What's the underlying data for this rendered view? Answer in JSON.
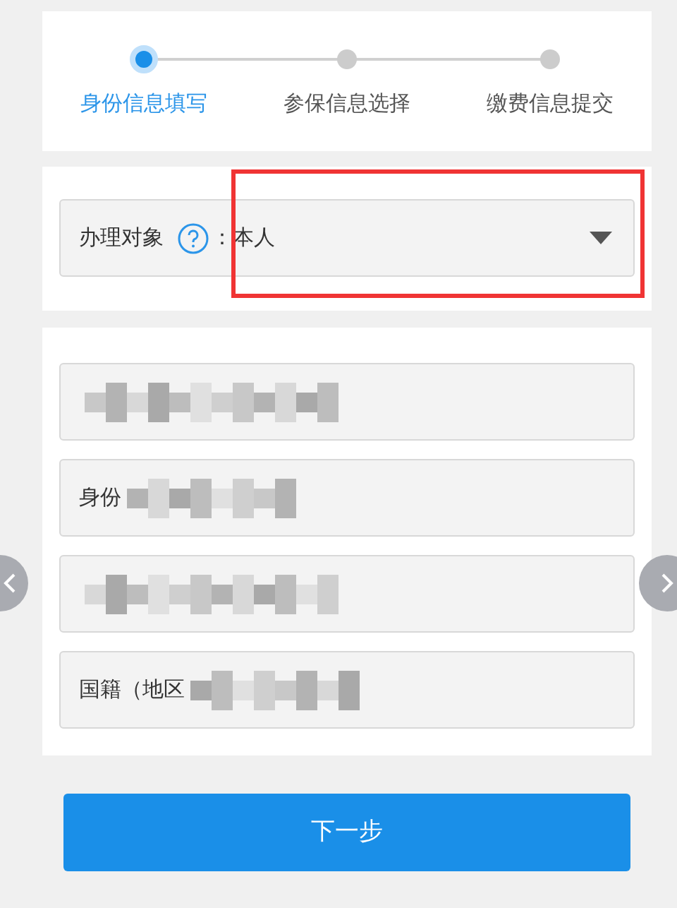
{
  "steps": [
    {
      "label": "身份信息填写",
      "selected": true
    },
    {
      "label": "参保信息选择",
      "selected": false
    },
    {
      "label": "缴费信息提交",
      "selected": false
    }
  ],
  "handling_target": {
    "label": "办理对象",
    "separator": "：",
    "value": "本人"
  },
  "fields": [
    {
      "redacted": true
    },
    {
      "label": "身份",
      "redacted": true
    },
    {
      "redacted": true
    },
    {
      "label": "国籍（地区",
      "redacted": true
    }
  ],
  "annotation": {
    "kind": "highlight-box"
  },
  "next_button": "下一步"
}
